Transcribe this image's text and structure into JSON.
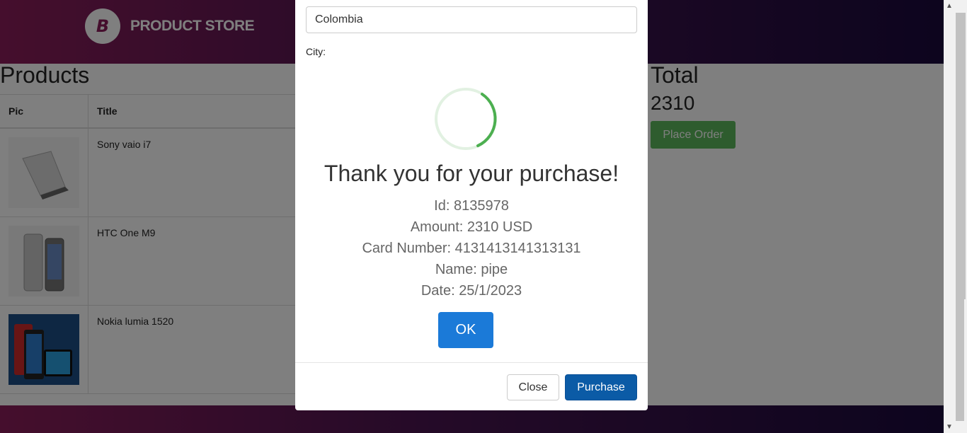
{
  "brand": {
    "logo_letter": "B",
    "name": "PRODUCT STORE"
  },
  "products": {
    "title": "Products",
    "columns": [
      "Pic",
      "Title"
    ],
    "rows": [
      {
        "title": "Sony vaio i7"
      },
      {
        "title": "HTC One M9"
      },
      {
        "title": "Nokia lumia 1520"
      }
    ]
  },
  "total": {
    "title": "Total",
    "value": "2310",
    "place_order_label": "Place Order"
  },
  "order_modal": {
    "country_value": "Colombia",
    "city_label": "City:",
    "close_label": "Close",
    "purchase_label": "Purchase"
  },
  "alert": {
    "title": "Thank you for your purchase!",
    "lines": [
      "Id: 8135978",
      "Amount: 2310 USD",
      "Card Number: 4131413141313131",
      "Name: pipe",
      "Date: 25/1/2023"
    ],
    "ok_label": "OK"
  },
  "colors": {
    "accent": "#8b1d5a",
    "success": "#5cb85c",
    "spinner": "#4caf50",
    "ok_button": "#1b7ad8",
    "purchase_button": "#0b5ba6"
  }
}
